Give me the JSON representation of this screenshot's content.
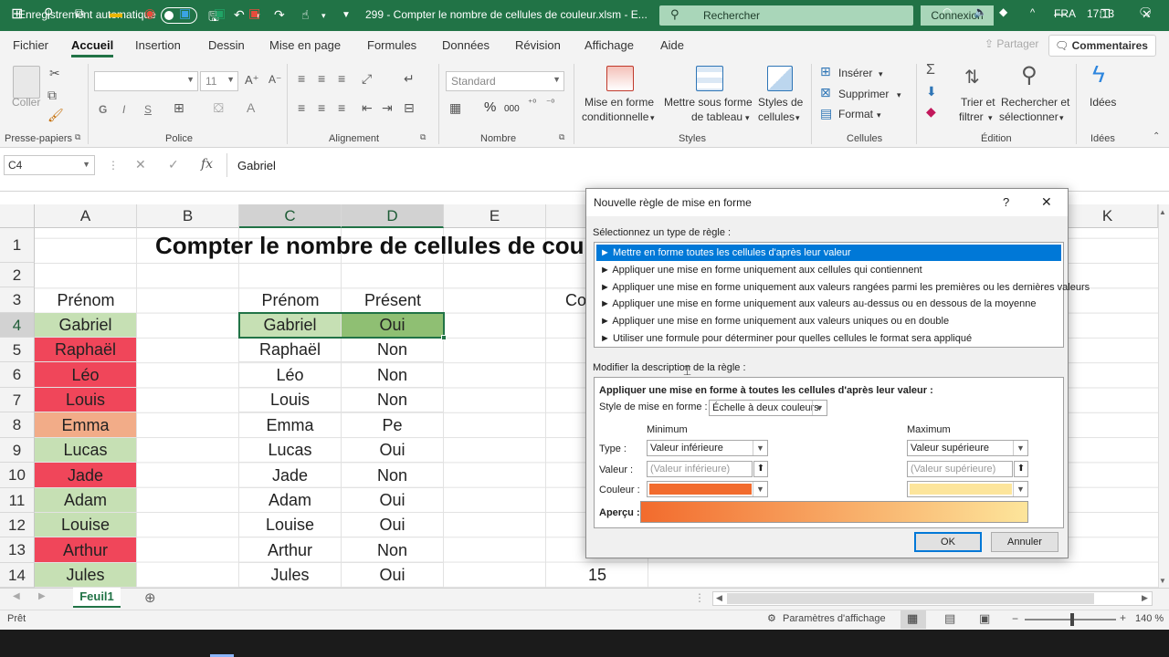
{
  "titlebar": {
    "autosave": "Enregistrement automatique",
    "filename": "299 - Compter le nombre de cellules de couleur.xlsm  -  E...",
    "search": "Rechercher",
    "signin": "Connexion",
    "min": "—",
    "restore": "❐",
    "close": "✕"
  },
  "tabs": [
    "Fichier",
    "Accueil",
    "Insertion",
    "Dessin",
    "Mise en page",
    "Formules",
    "Données",
    "Révision",
    "Affichage",
    "Aide"
  ],
  "share": "Partager",
  "comments": "Commentaires",
  "ribbon": {
    "paste": "Coller",
    "clipboard": "Presse-papiers",
    "font": "Police",
    "font_size": "11",
    "bold": "G",
    "italic": "I",
    "underline": "S",
    "alignment": "Alignement",
    "number_format": "Standard",
    "number": "Nombre",
    "percent": "%",
    "thousands": "000",
    "cond_format_1": "Mise en forme",
    "cond_format_2": "conditionnelle",
    "table_format_1": "Mettre sous forme",
    "table_format_2": "de tableau",
    "cell_styles_1": "Styles de",
    "cell_styles_2": "cellules",
    "styles": "Styles",
    "insert": "Insérer",
    "delete": "Supprimer",
    "format": "Format",
    "cells": "Cellules",
    "sort_1": "Trier et",
    "sort_2": "filtrer",
    "find_1": "Rechercher et",
    "find_2": "sélectionner",
    "editing": "Édition",
    "ideas": "Idées",
    "ideas_group": "Idées"
  },
  "formula_bar": {
    "name_box": "C4",
    "cancel": "✕",
    "enter": "✓",
    "fx": "fx",
    "content": "Gabriel"
  },
  "sheet": {
    "columns": [
      "A",
      "B",
      "C",
      "D",
      "E",
      "K"
    ],
    "rows": [
      "1",
      "2",
      "3",
      "4",
      "5",
      "6",
      "7",
      "8",
      "9",
      "10",
      "11",
      "12",
      "13",
      "14"
    ],
    "title": "Compter le nombre de cellules de cou",
    "colA_header": "Prénom",
    "colC_header": "Prénom",
    "colD_header": "Présent",
    "colF_partial": "Co",
    "names_a": [
      "Gabriel",
      "Raphaël",
      "Léo",
      "Louis",
      "Emma",
      "Lucas",
      "Jade",
      "Adam",
      "Louise",
      "Arthur",
      "Jules"
    ],
    "names_c": [
      "Gabriel",
      "Raphaël",
      "Léo",
      "Louis",
      "Emma",
      "Lucas",
      "Jade",
      "Adam",
      "Louise",
      "Arthur",
      "Jules"
    ],
    "present": [
      "Oui",
      "Non",
      "Non",
      "Non",
      "Pe",
      "Oui",
      "Non",
      "Oui",
      "Oui",
      "Non",
      "Oui"
    ],
    "colF_row14": "15"
  },
  "colors": {
    "accent": "#217346",
    "green_fill": "#c6e0b4",
    "red_fill": "#f0465a",
    "orange_fill": "#f2ac88",
    "scale_min": "#f26b2d",
    "scale_max": "#fde59b",
    "selection_blue": "#0078d7"
  },
  "sheet_tab": "Feuil1",
  "status": {
    "ready": "Prêt",
    "display_settings": "Paramètres d'affichage",
    "zoom": "140 %"
  },
  "taskbar": {
    "lang": "FRA",
    "time": "17:13"
  },
  "dialog": {
    "title": "Nouvelle règle de mise en forme",
    "help": "?",
    "close": "✕",
    "select_type": "Sélectionnez un type de règle :",
    "rule_types": [
      "►  Mettre en forme toutes les cellules d'après leur valeur",
      "►  Appliquer une mise en forme uniquement aux cellules qui contiennent",
      "►  Appliquer une mise en forme uniquement aux valeurs rangées parmi les premières ou les dernières valeurs",
      "►  Appliquer une mise en forme uniquement aux valeurs au-dessus ou en dessous de la moyenne",
      "►  Appliquer une mise en forme uniquement aux valeurs uniques ou en double",
      "►  Utiliser une formule pour déterminer pour quelles cellules le format sera appliqué"
    ],
    "edit_desc": "Modifier la description de la règle :",
    "apply_title": "Appliquer une mise en forme à toutes les cellules d'après leur valeur :",
    "style_label": "Style de mise en forme :",
    "style_value": "Échelle à deux couleurs",
    "minimum": "Minimum",
    "maximum": "Maximum",
    "type_label": "Type :",
    "min_type": "Valeur inférieure",
    "max_type": "Valeur supérieure",
    "value_label": "Valeur :",
    "min_value_ph": "(Valeur inférieure)",
    "max_value_ph": "(Valeur supérieure)",
    "color_label": "Couleur :",
    "preview_label": "Aperçu :",
    "ok": "OK",
    "cancel": "Annuler"
  }
}
